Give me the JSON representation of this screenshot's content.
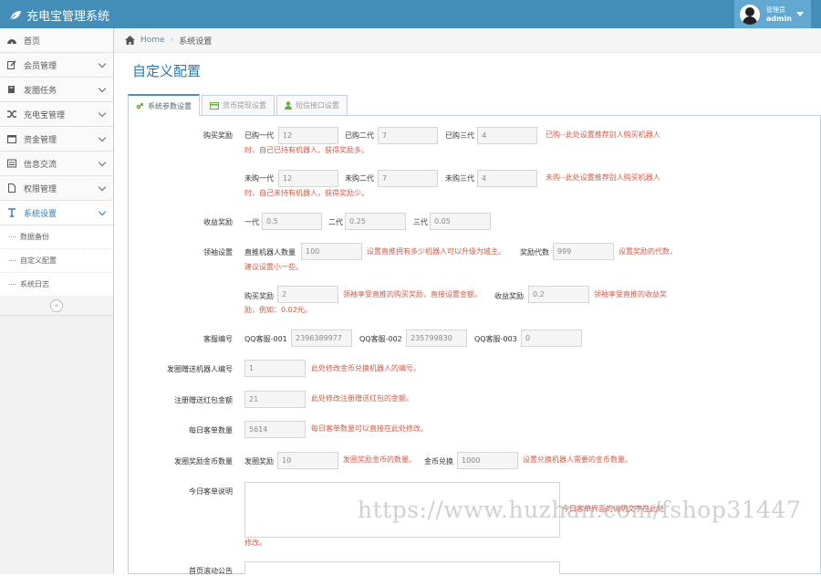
{
  "app": {
    "title": "充电宝管理系统"
  },
  "user": {
    "role": "管理员",
    "name": "admin"
  },
  "sidebar": {
    "items": [
      {
        "label": "首页",
        "icon": "dashboard-icon"
      },
      {
        "label": "会员管理",
        "icon": "edit-icon"
      },
      {
        "label": "发圈任务",
        "icon": "book-icon"
      },
      {
        "label": "充电宝管理",
        "icon": "shuffle-icon"
      },
      {
        "label": "资金管理",
        "icon": "calendar-icon"
      },
      {
        "label": "信息交流",
        "icon": "list-icon"
      },
      {
        "label": "权限管理",
        "icon": "file-icon"
      },
      {
        "label": "系统设置",
        "icon": "text-icon"
      }
    ],
    "subitems": [
      "数据备份",
      "自定义配置",
      "系统日志"
    ]
  },
  "breadcrumb": {
    "home": "Home",
    "current": "系统设置"
  },
  "page": {
    "title": "自定义配置"
  },
  "tabs": [
    "系统参数设置",
    "货币提现设置",
    "短信接口设置"
  ],
  "form": {
    "buy_reward": {
      "label": "购买奖励",
      "bought_labels": [
        "已购一代",
        "已购二代",
        "已购三代"
      ],
      "bought_values": [
        "12",
        "7",
        "4"
      ],
      "bought_help_1": "已购--此处设置推荐别人购买机器人",
      "bought_help_2": "时，自己已持有机器人，获得奖励多。",
      "unbought_labels": [
        "未购一代",
        "未购二代",
        "未购三代"
      ],
      "unbought_values": [
        "12",
        "7",
        "4"
      ],
      "unbought_help_1": "未购--此处设置推荐别人购买机器人",
      "unbought_help_2": "时，自己未持有机器人，获得奖励少。"
    },
    "income_reward": {
      "label": "收益奖励",
      "labels": [
        "一代",
        "二代",
        "三代"
      ],
      "values": [
        "0.5",
        "0.25",
        "0.05"
      ]
    },
    "leader": {
      "label": "领袖设置",
      "direct_label": "直推机器人数量",
      "direct_value": "100",
      "direct_help": "设置直推拥有多少机器人可以升级为城主。",
      "gen_label": "奖励代数",
      "gen_value": "999",
      "gen_help_1": "设置奖励的代数，",
      "gen_help_2": "建议设置小一些。",
      "buy_label": "购买奖励",
      "buy_value": "2",
      "buy_help": "领袖享受直推的购买奖励，直接设置金额。",
      "income_label": "收益奖励",
      "income_value": "0.2",
      "income_help_1": "领袖享受直推的收益奖",
      "income_help_2": "励，例如：0.02元。"
    },
    "service": {
      "label": "客服编号",
      "labels": [
        "QQ客服-001",
        "QQ客服-002",
        "QQ客服-003"
      ],
      "values": [
        "2396389977",
        "235799830",
        "0"
      ]
    },
    "gift_robot": {
      "label": "发圈赠送机器人编号",
      "value": "1",
      "help": "此处修改金币兑换机器人的编号。"
    },
    "signup_gift": {
      "label": "注册赠送红包金额",
      "value": "21",
      "help": "此处修改注册赠送红包的金额。"
    },
    "daily_orders": {
      "label": "每日客单数量",
      "value": "5614",
      "help": "每日客单数量可以直接在此处修改。"
    },
    "coin_reward": {
      "label": "发圈奖励金币数量",
      "reward_label": "发圈奖励",
      "reward_value": "10",
      "reward_help": "发圈奖励金币的数量。",
      "exchange_label": "金币兑换",
      "exchange_value": "1000",
      "exchange_help": "设置兑换机器人需要的金币数量。"
    },
    "daily_note": {
      "label": "今日客单说明",
      "help_1": "今日客单界面的说明文字在此处",
      "help_2": "修改。"
    },
    "notice": {
      "label": "首页滚动公告"
    }
  },
  "watermark": "https://www.huzhan.com/fshop31447"
}
